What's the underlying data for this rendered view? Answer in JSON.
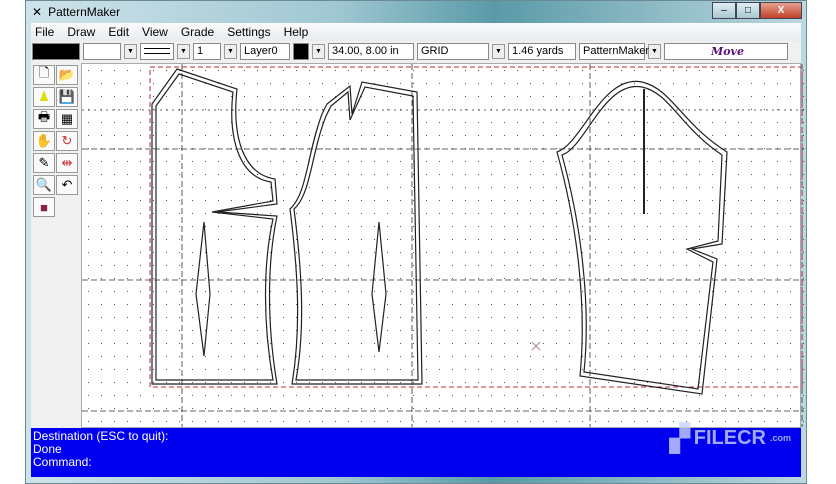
{
  "window": {
    "title": "PatternMaker"
  },
  "menu": [
    "File",
    "Draw",
    "Edit",
    "View",
    "Grade",
    "Settings",
    "Help"
  ],
  "toolbar": {
    "line_width": "1",
    "layer": "Layer0",
    "coords": "34.00, 8.00 in",
    "snap": "GRID",
    "length": "1.46 yards",
    "mode_select": "PatternMaker",
    "mode": "Move"
  },
  "status": {
    "lines": [
      "Destination (ESC to quit):",
      "Done",
      "Command:"
    ],
    "watermark": "FILECR",
    "watermark_sub": ".com"
  },
  "colors": {
    "status_bg": "#0000ee",
    "mode_text": "#5a1070",
    "border_red": "#b03030"
  }
}
